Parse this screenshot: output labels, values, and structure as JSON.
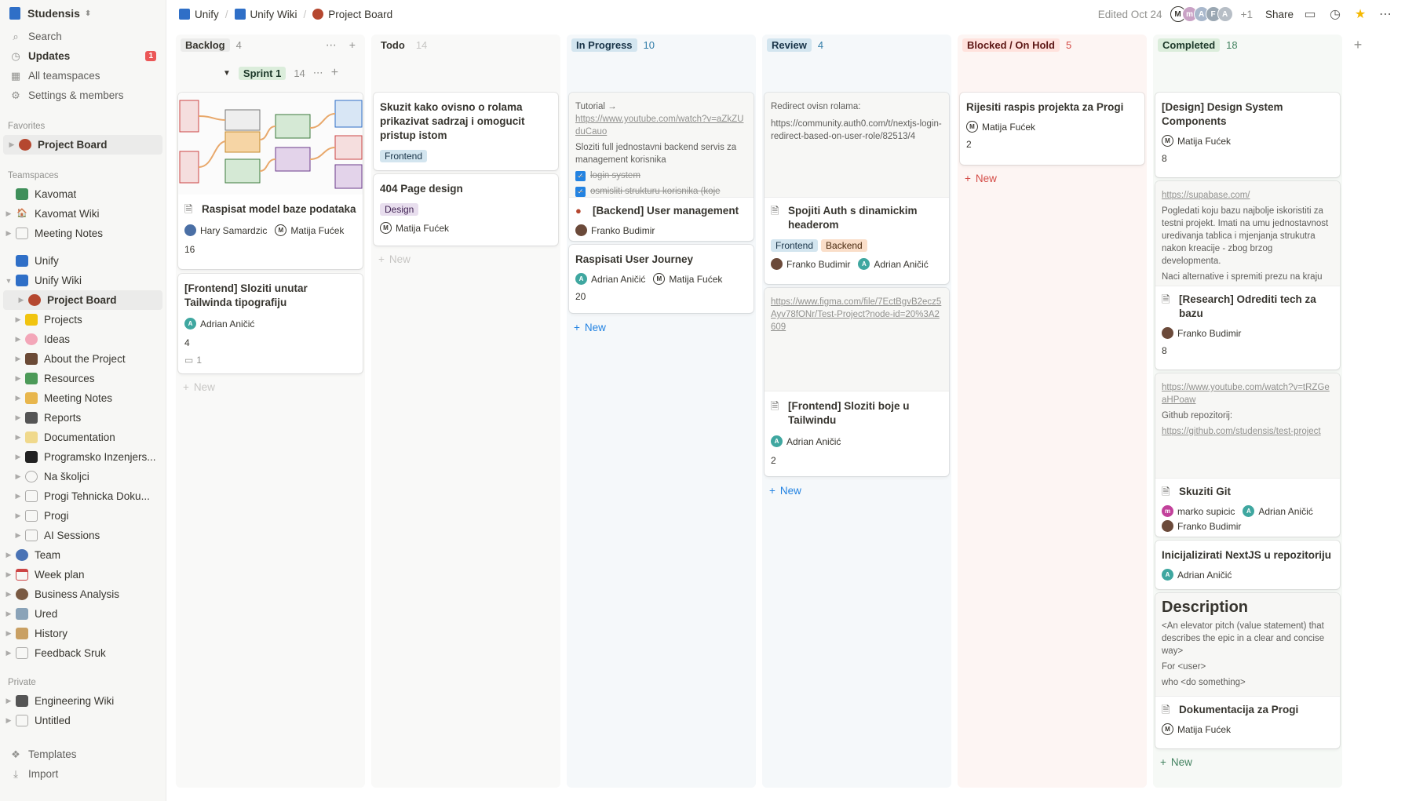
{
  "sidebar": {
    "workspace": "Studensis",
    "nav": [
      {
        "icon": "search-icon",
        "label": "Search"
      },
      {
        "icon": "clock-icon",
        "label": "Updates",
        "badge": "1"
      },
      {
        "icon": "grid-icon",
        "label": "All teamspaces"
      },
      {
        "icon": "gear-icon",
        "label": "Settings & members"
      }
    ],
    "favorites_label": "Favorites",
    "favorites": [
      {
        "label": "Project Board"
      }
    ],
    "teamspaces_label": "Teamspaces",
    "kavomat": "Kavomat",
    "kavomat_items": [
      "Kavomat Wiki",
      "Meeting Notes"
    ],
    "unify": "Unify",
    "unify_wiki": "Unify Wiki",
    "wiki_items": [
      "Project Board",
      "Projects",
      "Ideas",
      "About the Project",
      "Resources",
      "Meeting Notes",
      "Reports",
      "Documentation",
      "Programsko Inzenjers...",
      "Na školjci",
      "Progi Tehnicka Doku...",
      "Progi",
      "AI Sessions"
    ],
    "unify_items": [
      "Team",
      "Week plan",
      "Business Analysis",
      "Ured",
      "History",
      "Feedback Sruk"
    ],
    "private_label": "Private",
    "private_items": [
      "Engineering Wiki",
      "Untitled"
    ],
    "templates": "Templates",
    "import": "Import"
  },
  "topbar": {
    "crumbs": [
      "Unify",
      "Unify Wiki",
      "Project Board"
    ],
    "edited": "Edited Oct 24",
    "extra_count": "+1",
    "share": "Share"
  },
  "columns": [
    {
      "name": "Backlog",
      "count": "4"
    },
    {
      "name": "Todo",
      "count": "14"
    },
    {
      "name": "In Progress",
      "count": "10"
    },
    {
      "name": "Review",
      "count": "4"
    },
    {
      "name": "Blocked / On Hold",
      "count": "5"
    },
    {
      "name": "Completed",
      "count": "18"
    }
  ],
  "group": {
    "name": "Sprint 1",
    "count": "14"
  },
  "new_label": "New",
  "cards": {
    "b1": {
      "title": "Raspisat model baze podataka",
      "people": [
        "Hary Samardzic",
        "Matija Fućek"
      ],
      "num": "16"
    },
    "b2": {
      "title": "[Frontend] Sloziti unutar Tailwinda tipografiju",
      "people": [
        "Adrian Aničić"
      ],
      "num": "4",
      "comments": "1"
    },
    "t1": {
      "title": "Skuzit kako ovisno o rolama prikazivat sadrzaj i omogucit pristup istom",
      "tag": "Frontend"
    },
    "t2": {
      "title": "404 Page design",
      "tag": "Design",
      "people": [
        "Matija Fućek"
      ]
    },
    "p1": {
      "preview_title": "Tutorial →",
      "preview_link": "https://www.youtube.com/watch?v=aZkZUduCauo",
      "preview_text": "Sloziti full jednostavni backend servis za management korisnika",
      "check1": "login system",
      "check2": "osmisliti strukturu korisnika (koje",
      "title": "[Backend] User management",
      "people": [
        "Franko Budimir"
      ]
    },
    "p2": {
      "title": "Raspisati User Journey",
      "people": [
        "Adrian Aničić",
        "Matija Fućek"
      ],
      "num": "20"
    },
    "r1": {
      "preview_title": "Redirect ovisn rolama:",
      "preview_link": "https://community.auth0.com/t/nextjs-login-redirect-based-on-user-role/82513/4",
      "title": "Spojiti Auth s dinamickim headerom",
      "tags": [
        "Frontend",
        "Backend"
      ],
      "people": [
        "Franko Budimir",
        "Adrian Aničić"
      ]
    },
    "r2": {
      "preview_link": "https://www.figma.com/file/7EctBgvB2ecz5Ayv78fONr/Test-Project?node-id=20%3A2609",
      "title": "[Frontend] Sloziti boje u Tailwindu",
      "people": [
        "Adrian Aničić"
      ],
      "num": "2"
    },
    "k1": {
      "title": "Rijesiti raspis projekta za Progi",
      "people": [
        "Matija Fućek"
      ],
      "num": "2"
    },
    "c1": {
      "title": "[Design] Design System Components",
      "people": [
        "Matija Fućek"
      ],
      "num": "8"
    },
    "c2": {
      "preview_link": "https://supabase.com/",
      "preview_text": "Pogledati koju bazu najbolje iskoristiti za testni projekt. Imati na umu jednostavnost uredivanja tablica i mjenjanja strukutra nakon kreacije - zbog brzog developmenta.",
      "preview_text2": "Naci alternative i spremiti prezu na kraju",
      "title": "[Research] Odrediti tech za bazu",
      "people": [
        "Franko Budimir"
      ],
      "num": "8"
    },
    "c3": {
      "preview_link": "https://www.youtube.com/watch?v=tRZGeaHPoaw",
      "preview_text": "Github repozitorij:",
      "preview_link2": "https://github.com/studensis/test-project",
      "title": "Skuziti Git",
      "people": [
        "marko supicic",
        "Adrian Aničić",
        "Franko Budimir"
      ]
    },
    "c4": {
      "title": "Inicijalizirati NextJS u repozitoriju",
      "people": [
        "Adrian Aničić"
      ]
    },
    "c5": {
      "preview_heading": "Description",
      "preview_text": "<An elevator pitch (value statement) that describes the epic in a clear and concise way>",
      "preview_for": "For <user>",
      "preview_who": "who <do something>",
      "title": "Dokumentacija za Progi",
      "people": [
        "Matija Fućek"
      ]
    }
  },
  "colors": {
    "accent": "#2383e2",
    "badge": "#eb5757"
  }
}
